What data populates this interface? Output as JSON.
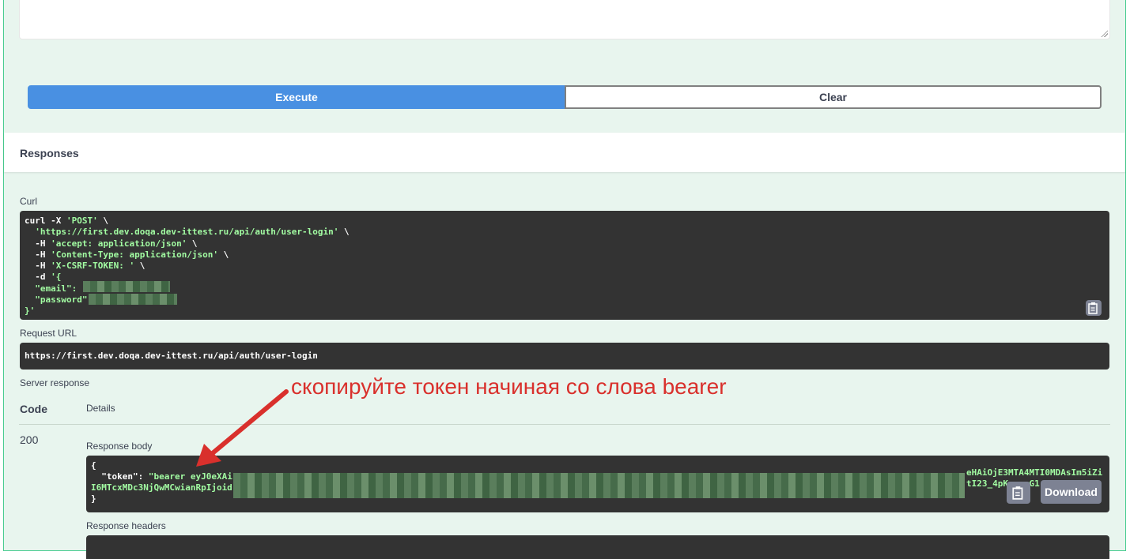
{
  "actions": {
    "execute_label": "Execute",
    "clear_label": "Clear"
  },
  "responses": {
    "title": "Responses"
  },
  "curl": {
    "label": "Curl",
    "line1_cmd": "curl -X ",
    "line1_method": "'POST'",
    "line1_tail": " \\",
    "line2_url": "  'https://first.dev.doqa.dev-ittest.ru/api/auth/user-login'",
    "line2_tail": " \\",
    "line3_flag": "  -H ",
    "line3_val": "'accept: application/json'",
    "line3_tail": " \\",
    "line4_flag": "  -H ",
    "line4_val": "'Content-Type: application/json'",
    "line4_tail": " \\",
    "line5_flag": "  -H ",
    "line5_val": "'X-CSRF-TOKEN: '",
    "line5_tail": " \\",
    "line6_flag": "  -d ",
    "line6_val": "'{",
    "line7": "  \"email\": ",
    "line8": "  \"password\"",
    "line9": "}'"
  },
  "request_url": {
    "label": "Request URL",
    "value": "https://first.dev.doqa.dev-ittest.ru/api/auth/user-login"
  },
  "server_response": {
    "label": "Server response",
    "code_header": "Code",
    "details_header": "Details",
    "code": "200",
    "body_label": "Response body",
    "body_open": "{",
    "token_key": "  \"token\": ",
    "token_start": "\"bearer eyJ0eXAi",
    "token_tail": "eHAiOjE3MTA4MTI0MDAsIm5iZi",
    "line2_start": "I6MTcxMDc3NjQwMCwianRpIjoid",
    "line2_tail": "tI23_4pK    G1",
    "body_close": "}",
    "download_label": "Download",
    "headers_label": "Response headers"
  },
  "annotation": {
    "text": "скопируйте токен начиная со слова bearer",
    "color": "#d9302c"
  },
  "colors": {
    "execute": "#4990e2",
    "block_bg": "#e8f5ee",
    "code_bg": "#333333",
    "string": "#a2fca2"
  }
}
